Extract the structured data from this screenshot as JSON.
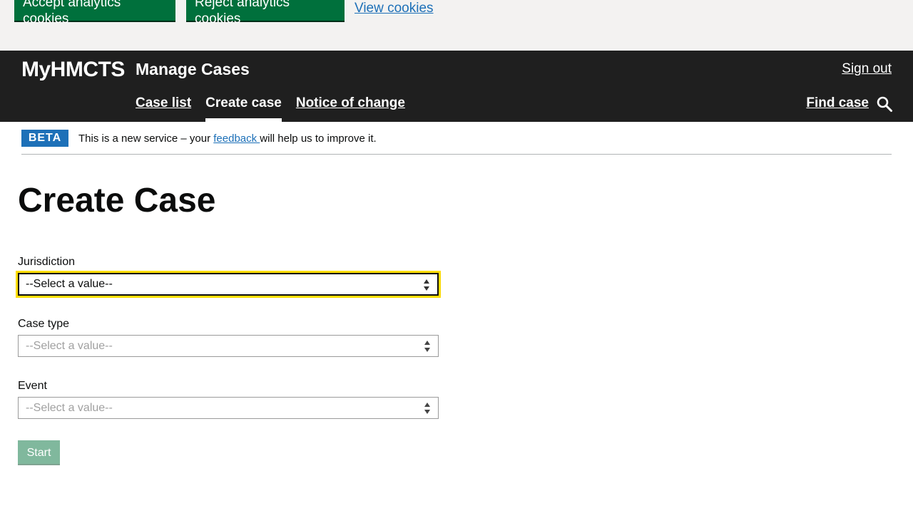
{
  "cookie_banner": {
    "accept_label": "Accept analytics cookies",
    "reject_label": "Reject analytics cookies",
    "view_label": "View cookies"
  },
  "header": {
    "logo": "MyHMCTS",
    "service_name": "Manage Cases",
    "sign_out": "Sign out",
    "nav": {
      "case_list": "Case list",
      "create_case": "Create case",
      "notice_of_change": "Notice of change"
    },
    "active_nav": "Create case",
    "find_case": "Find case"
  },
  "phase_banner": {
    "tag": "BETA",
    "text_before": "This is a new service – your ",
    "link": " feedback ",
    "text_after": " will help us to improve it."
  },
  "main": {
    "title": "Create Case",
    "jurisdiction": {
      "label": "Jurisdiction",
      "value": "--Select a value--"
    },
    "case_type": {
      "label": "Case type",
      "value": "--Select a value--"
    },
    "event": {
      "label": "Event",
      "value": "--Select a value--"
    },
    "start_label": "Start"
  },
  "colors": {
    "button_green": "#00703c",
    "header_bg": "#1f1f1f",
    "link_blue": "#1d70b8",
    "focus_yellow": "#ffdd00",
    "disabled_green": "#80b89d"
  },
  "icons": [
    "search-icon",
    "select-arrows-icon"
  ]
}
